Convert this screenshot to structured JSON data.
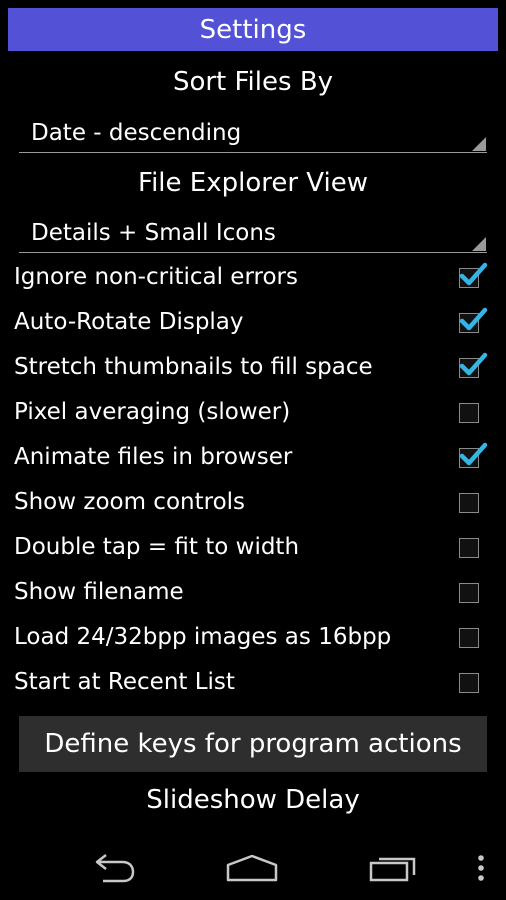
{
  "title": "Settings",
  "sections": {
    "sort": {
      "heading": "Sort Files By",
      "value": "Date - descending"
    },
    "view": {
      "heading": "File Explorer View",
      "value": "Details + Small Icons"
    }
  },
  "options": [
    {
      "label": "Ignore non-critical errors",
      "checked": true
    },
    {
      "label": "Auto-Rotate Display",
      "checked": true
    },
    {
      "label": "Stretch thumbnails to fill space",
      "checked": true
    },
    {
      "label": "Pixel averaging (slower)",
      "checked": false
    },
    {
      "label": "Animate files in browser",
      "checked": true
    },
    {
      "label": "Show zoom controls",
      "checked": false
    },
    {
      "label": "Double tap = fit to width",
      "checked": false
    },
    {
      "label": "Show filename",
      "checked": false
    },
    {
      "label": "Load 24/32bpp images as 16bpp",
      "checked": false
    },
    {
      "label": "Start at Recent List",
      "checked": false
    }
  ],
  "define_keys_button": "Define keys for program actions",
  "slideshow": {
    "heading": "Slideshow Delay"
  },
  "colors": {
    "title_bar": "#5351d6",
    "check_accent": "#33b5e5",
    "background": "#000000"
  },
  "icons": {
    "back": "back-icon",
    "home": "home-icon",
    "recents": "recent-apps-icon",
    "menu": "overflow-menu-icon"
  }
}
